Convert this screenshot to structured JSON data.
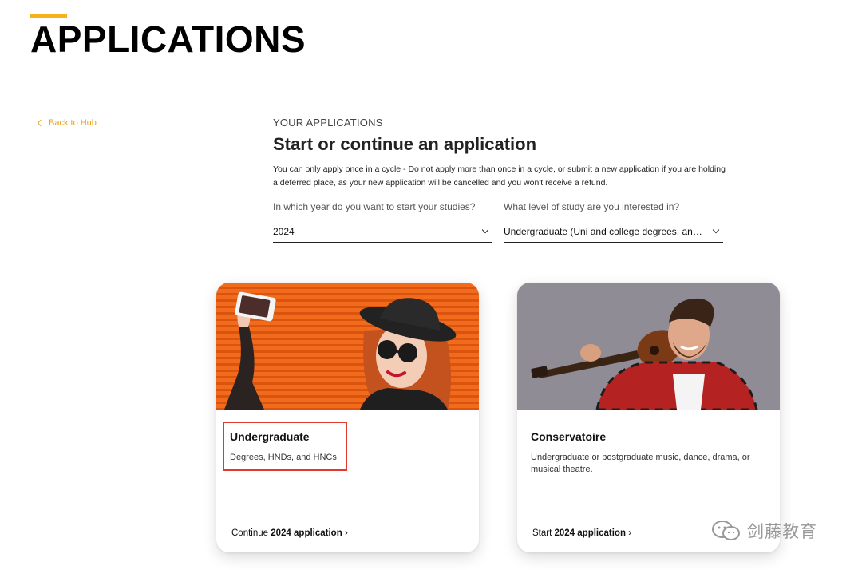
{
  "header": {
    "title": "APPLICATIONS"
  },
  "nav": {
    "back_label": "Back to Hub"
  },
  "main": {
    "eyebrow": "YOUR APPLICATIONS",
    "heading": "Start or continue an application",
    "notice": "You can only apply once in a cycle - Do not apply more than once in a cycle, or submit a new application if you are holding a deferred place, as your new application will be cancelled and you won't receive a refund.",
    "year_field": {
      "label": "In which year do you want to start your studies?",
      "value": "2024"
    },
    "level_field": {
      "label": "What level of study are you interested in?",
      "value": "Undergraduate (Uni and college degrees, and ap…"
    }
  },
  "cards": [
    {
      "title": "Undergraduate",
      "description": "Degrees, HNDs, and HNCs",
      "cta_prefix": "Continue",
      "cta_bold": "2024 application",
      "cta_suffix": "›"
    },
    {
      "title": "Conservatoire",
      "description": "Undergraduate or postgraduate music, dance, drama, or musical theatre.",
      "cta_prefix": "Start",
      "cta_bold": "2024 application",
      "cta_suffix": "›"
    }
  ],
  "watermark": {
    "text": "剑藤教育",
    "icon": "wechat-icon"
  },
  "colors": {
    "accent": "#f5b21a",
    "link": "#e8a317",
    "highlight": "#e03a2f"
  }
}
